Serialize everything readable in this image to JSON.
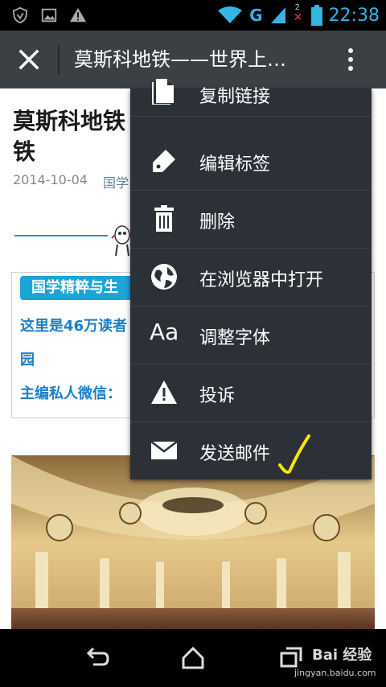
{
  "status_bar": {
    "time": "22:38",
    "network_type": "G",
    "signal_icon": "signal-icon",
    "wifi_icon": "wifi-icon",
    "battery_icon": "battery-icon",
    "sim2_marker": "2"
  },
  "toolbar": {
    "title": "莫斯科地铁——世界上…",
    "close_icon": "close-icon",
    "more_icon": "more-vert-icon"
  },
  "article": {
    "title": "莫斯科地铁",
    "title_line2": "铁",
    "date": "2014-10-04",
    "source": "国学",
    "card": {
      "tag": "国学精粹与生",
      "line1": "这里是46万读者",
      "line2": "园",
      "line3": "主编私人微信："
    }
  },
  "menu": {
    "items": [
      {
        "label": "复制链接",
        "icon": "copy-icon"
      },
      {
        "label": "编辑标签",
        "icon": "tag-icon"
      },
      {
        "label": "删除",
        "icon": "trash-icon"
      },
      {
        "label": "在浏览器中打开",
        "icon": "globe-icon"
      },
      {
        "label": "调整字体",
        "icon": "font-size-icon",
        "glyph": "Aa"
      },
      {
        "label": "投诉",
        "icon": "warning-icon"
      },
      {
        "label": "发送邮件",
        "icon": "mail-icon"
      }
    ]
  },
  "watermark": {
    "text": "Bai 经验",
    "url": "jingyan.baidu.com"
  },
  "colors": {
    "accent": "#33b5e5",
    "toolbar_bg": "#3b4045",
    "menu_bg": "#2b3136",
    "tag_bg": "#1ca4d6",
    "link": "#1a7fc8",
    "annotation": "#ffe600"
  }
}
